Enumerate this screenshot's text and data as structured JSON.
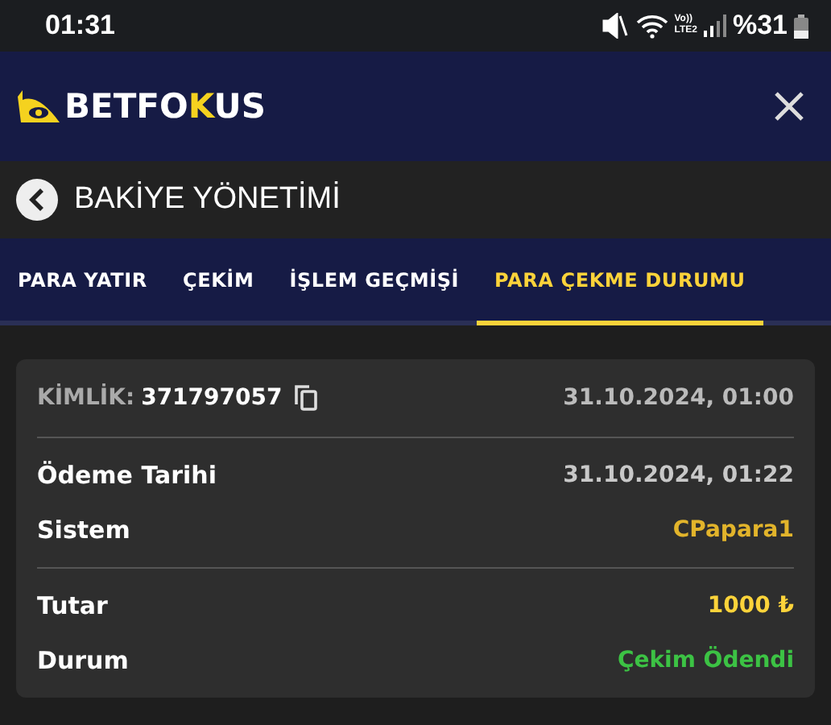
{
  "status_bar": {
    "time": "01:31",
    "network_top": "Vo))",
    "network_bottom": "LTE2",
    "battery": "%31"
  },
  "header": {
    "logo": [
      {
        "text": "BETFO",
        "highlight": false
      },
      {
        "text": "K",
        "highlight": true
      },
      {
        "text": "US",
        "highlight": false
      }
    ]
  },
  "page_title": "BAKİYE YÖNETİMİ",
  "tabs": [
    {
      "label": "PARA YATIR",
      "selected": false
    },
    {
      "label": "ÇEKİM",
      "selected": false
    },
    {
      "label": "İŞLEM GEÇMİŞİ",
      "selected": false
    },
    {
      "label": "PARA ÇEKME DURUMU",
      "selected": true
    }
  ],
  "card": {
    "id_label": "KİMLİK:",
    "id_value": "371797057",
    "created": "31.10.2024, 01:00",
    "sections": [
      {
        "rows": [
          {
            "label": "Ödeme Tarihi",
            "value": "31.10.2024, 01:22",
            "color": "#c8c8c8"
          },
          {
            "label": "Sistem",
            "value": "CPapara1",
            "color": "#e2b42b"
          }
        ]
      },
      {
        "rows": [
          {
            "label": "Tutar",
            "value": "1000 ₺",
            "color": "#fcd33a"
          },
          {
            "label": "Durum",
            "value": "Çekim Ödendi",
            "color": "#3cc244"
          }
        ]
      }
    ]
  }
}
